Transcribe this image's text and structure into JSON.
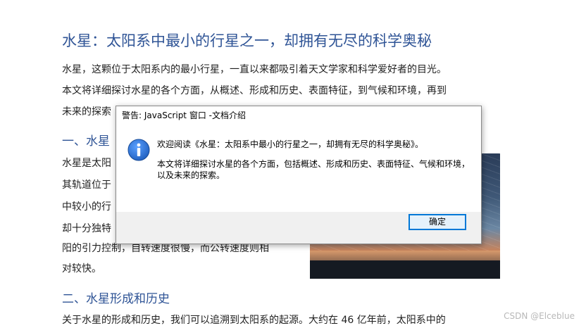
{
  "document": {
    "title": "水星：太阳系中最小的行星之一，却拥有无尽的科学奥秘",
    "intro_lines": [
      "水星，这颗位于太阳系内的最小行星，一直以来都吸引着天文学家和科学爱好者的目光。",
      "本文将详细探讨水星的各个方面，从概述、形成和历史、表面特征，到气候和环境，再到",
      "未来的探索"
    ],
    "section1_heading": "一、水星",
    "section1_lines": [
      "水星是太阳",
      "其轨道位于",
      "中较小的行",
      "却十分独特",
      "阳的引力控制，自转速度很慢，而公转速度则相",
      "对较快。"
    ],
    "section2_heading": "二、水星形成和历史",
    "section2_line": "关于水星的形成和历史，我们可以追溯到太阳系的起源。大约在 46 亿年前，太阳系中的"
  },
  "watermark": "CSDN @Elceblue",
  "dialog": {
    "title": "警告: JavaScript 窗口 -文档介绍",
    "icon": "info-icon",
    "message_line1": "欢迎阅读《水星：太阳系中最小的行星之一，却拥有无尽的科学奥秘》。",
    "message_line2": "本文将详细探讨水星的各个方面，包括概述、形成和历史、表面特征、气候和环境，以及未来的探索。",
    "ok_label": "确定"
  },
  "colors": {
    "heading": "#2f5496",
    "button_border": "#0078d7",
    "icon_blue": "#1f5fbf"
  }
}
